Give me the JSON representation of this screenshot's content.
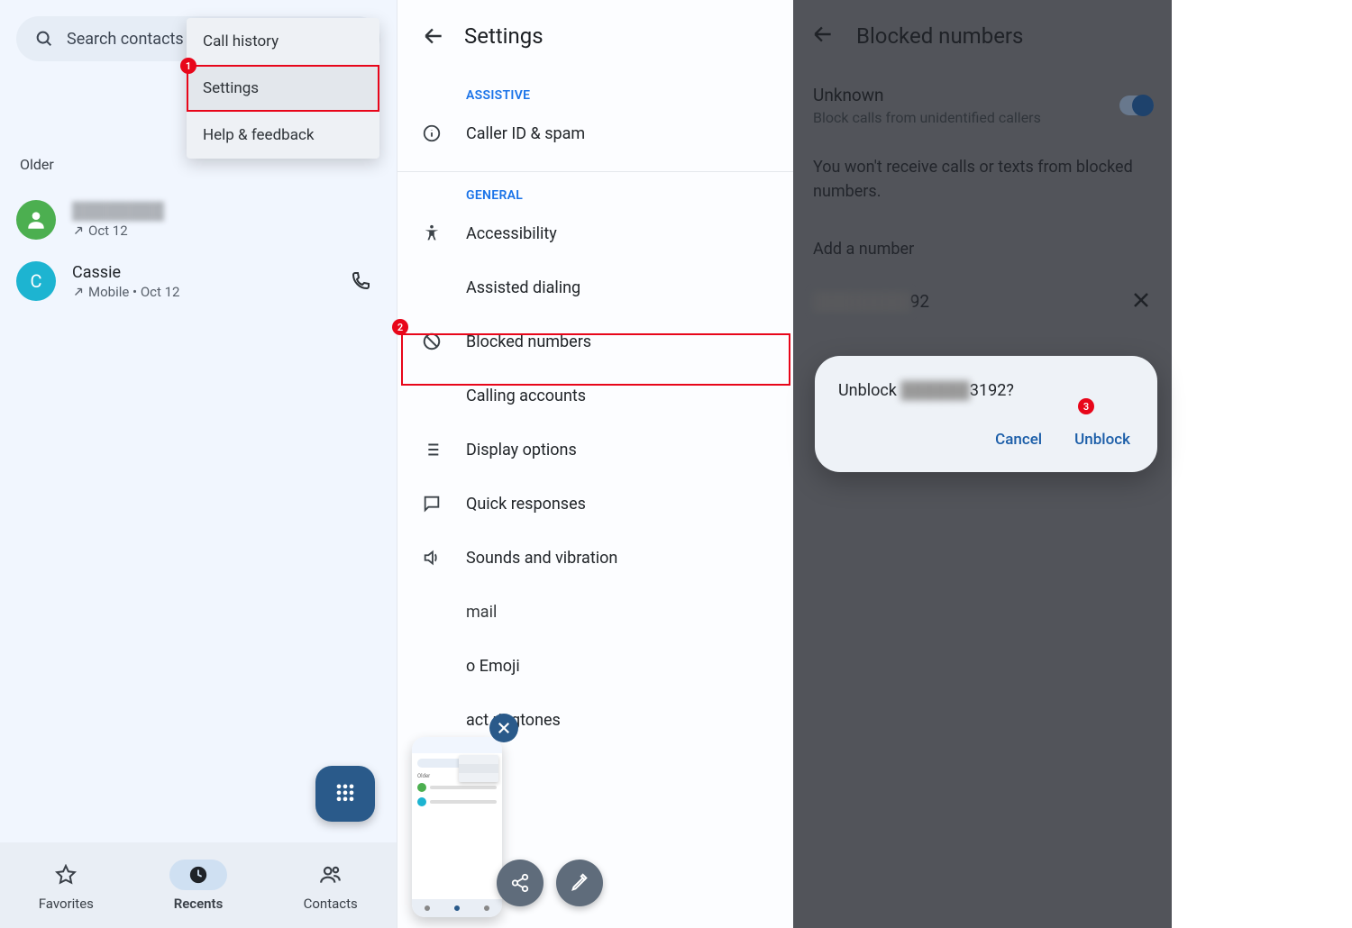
{
  "panel1": {
    "search_placeholder": "Search contacts",
    "section_older": "Older",
    "menu": {
      "history": "Call history",
      "settings": "Settings",
      "help": "Help & feedback"
    },
    "contacts": [
      {
        "name": "",
        "meta": "Oct 12"
      },
      {
        "name": "Cassie",
        "meta": "Mobile • Oct 12"
      }
    ],
    "nav": {
      "favorites": "Favorites",
      "recents": "Recents",
      "contacts": "Contacts"
    }
  },
  "panel2": {
    "title": "Settings",
    "group_assistive": "ASSISTIVE",
    "group_general": "GENERAL",
    "items": {
      "caller_id": "Caller ID & spam",
      "accessibility": "Accessibility",
      "assisted_dialing": "Assisted dialing",
      "blocked": "Blocked numbers",
      "calling_accounts": "Calling accounts",
      "display": "Display options",
      "quick": "Quick responses",
      "sounds": "Sounds and vibration",
      "emoji": "o Emoji",
      "ringtones": "act ringtones",
      "mail": "mail"
    }
  },
  "panel3": {
    "title": "Blocked numbers",
    "unknown_label": "Unknown",
    "unknown_sub": "Block calls from unidentified callers",
    "info": "You won't receive calls or texts from blocked numbers.",
    "add": "Add a number",
    "number_suffix": "92",
    "dialog": {
      "prefix": "Unblock ",
      "suffix": "3192?",
      "cancel": "Cancel",
      "unblock": "Unblock"
    }
  },
  "badges": {
    "b1": "1",
    "b2": "2",
    "b3": "3"
  }
}
